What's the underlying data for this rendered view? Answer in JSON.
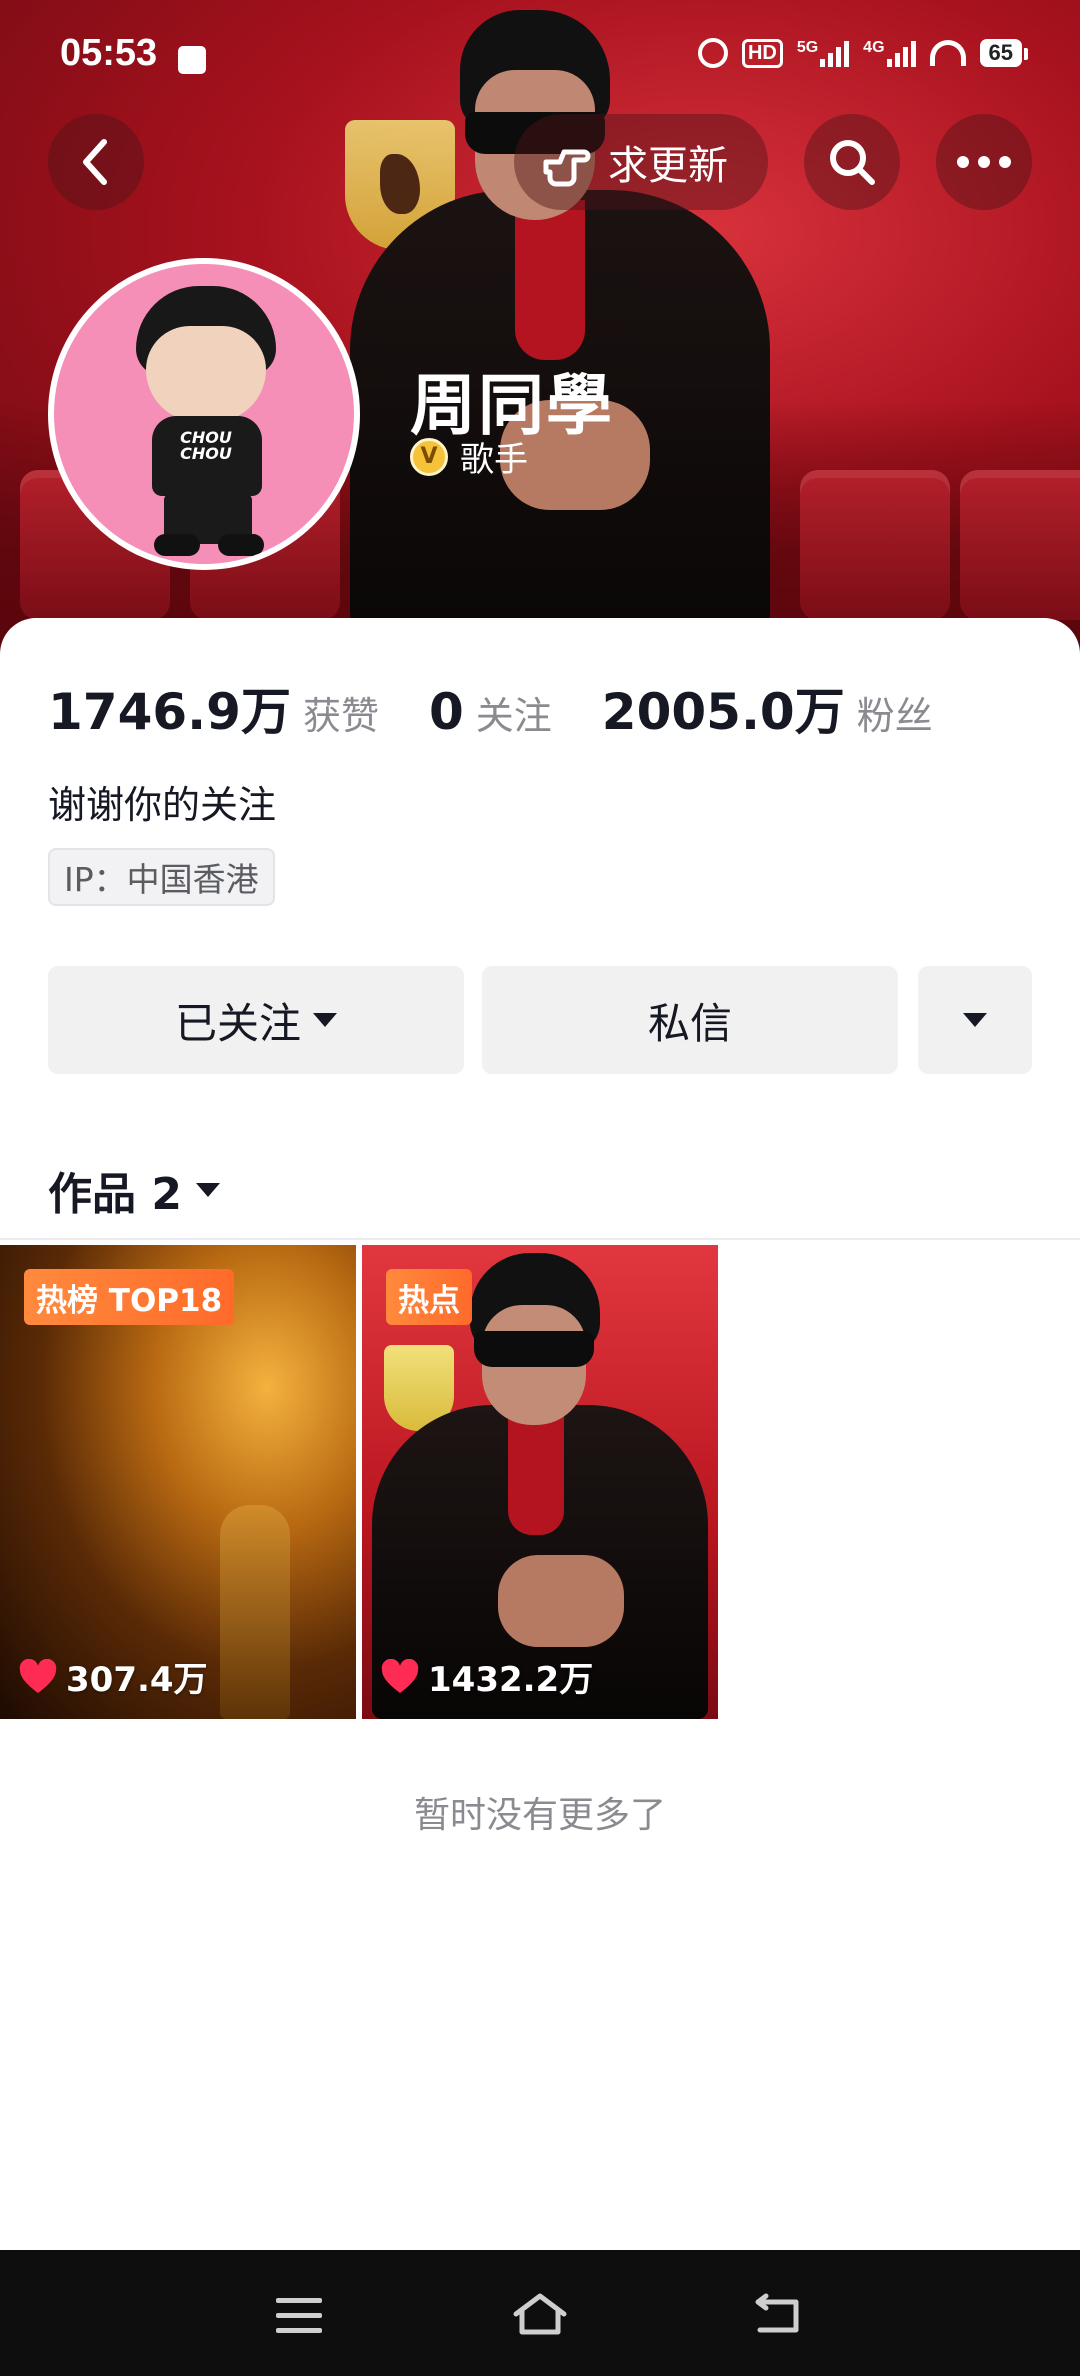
{
  "status_bar": {
    "time": "05:53",
    "battery": "65",
    "hd_label": "HD",
    "net_5g": "5G",
    "net_4g": "4G"
  },
  "top_nav": {
    "request_update_label": "求更新"
  },
  "profile": {
    "name": "周同學",
    "verify_badge": "V",
    "role": "歌手",
    "avatar_shirt_text": "CHOU CHOU",
    "likes_count": "1746.9万",
    "likes_label": "获赞",
    "following_count": "0",
    "following_label": "关注",
    "followers_count": "2005.0万",
    "followers_label": "粉丝",
    "bio": "谢谢你的关注",
    "ip_location": "IP：中国香港"
  },
  "actions": {
    "followed_label": "已关注",
    "message_label": "私信"
  },
  "works": {
    "header": "作品 2",
    "items": [
      {
        "tag": "热榜 TOP18",
        "likes": "307.4万"
      },
      {
        "tag": "热点",
        "likes": "1432.2万"
      }
    ],
    "end_text": "暂时没有更多了"
  },
  "colors": {
    "banner_red": "#a8121e",
    "tag_orange": "#ff7a33",
    "heart_red": "#fe2c55",
    "verify_gold": "#f5c23a"
  },
  "icons": [
    "back-icon",
    "pointing-hand-icon",
    "search-icon",
    "more-icon",
    "caret-down-icon",
    "heart-icon",
    "menu-icon",
    "home-icon",
    "back-nav-icon"
  ]
}
